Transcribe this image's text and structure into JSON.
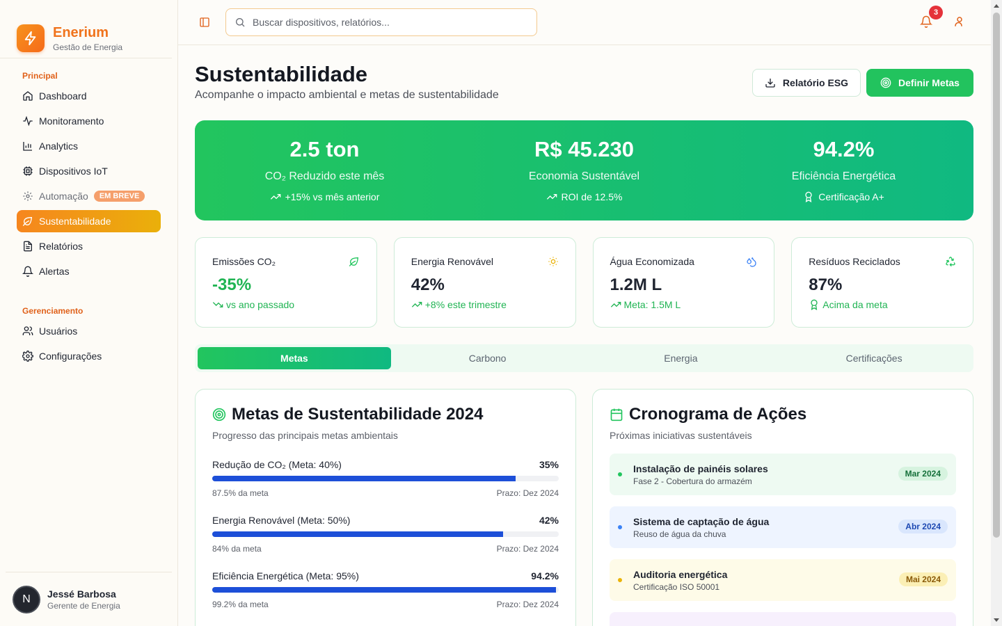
{
  "brand": {
    "name": "Enerium",
    "subtitle": "Gestão de Energia"
  },
  "sidebar": {
    "section_main": "Principal",
    "main_items": [
      {
        "label": "Dashboard",
        "icon": "home-icon"
      },
      {
        "label": "Monitoramento",
        "icon": "activity-icon"
      },
      {
        "label": "Analytics",
        "icon": "bar-chart-icon"
      },
      {
        "label": "Dispositivos IoT",
        "icon": "cpu-icon"
      },
      {
        "label": "Automação",
        "icon": "gear-icon",
        "badge": "EM BREVE"
      },
      {
        "label": "Sustentabilidade",
        "icon": "leaf-icon",
        "active": true
      },
      {
        "label": "Relatórios",
        "icon": "file-text-icon"
      },
      {
        "label": "Alertas",
        "icon": "bell-icon"
      }
    ],
    "section_manage": "Gerenciamento",
    "manage_items": [
      {
        "label": "Usuários",
        "icon": "users-icon"
      },
      {
        "label": "Configurações",
        "icon": "settings-icon"
      }
    ],
    "user": {
      "initial": "N",
      "name": "Jessé Barbosa",
      "role": "Gerente de Energia"
    }
  },
  "header": {
    "search_placeholder": "Buscar dispositivos, relatórios...",
    "notification_count": "3"
  },
  "page": {
    "title": "Sustentabilidade",
    "subtitle": "Acompanhe o impacto ambiental e metas de sustentabilidade",
    "btn_report": "Relatório ESG",
    "btn_goals": "Definir Metas"
  },
  "hero": [
    {
      "value": "2.5 ton",
      "label": "CO₂ Reduzido este mês",
      "note": "+15% vs mês anterior",
      "icon": "trending-up-icon"
    },
    {
      "value": "R$ 45.230",
      "label": "Economia Sustentável",
      "note": "ROI de 12.5%",
      "icon": "trending-up-icon"
    },
    {
      "value": "94.2%",
      "label": "Eficiência Energética",
      "note": "Certificação A+",
      "icon": "award-icon"
    }
  ],
  "cards": [
    {
      "title": "Emissões CO₂",
      "value": "-35%",
      "note": "vs ano passado",
      "icon": "leaf-icon"
    },
    {
      "title": "Energia Renovável",
      "value": "42%",
      "note": "+8% este trimestre",
      "icon": "sun-icon"
    },
    {
      "title": "Água Economizada",
      "value": "1.2M L",
      "note": "Meta: 1.5M L",
      "icon": "droplets-icon"
    },
    {
      "title": "Resíduos Reciclados",
      "value": "87%",
      "note": "Acima da meta",
      "icon": "recycle-icon"
    }
  ],
  "tabs": [
    "Metas",
    "Carbono",
    "Energia",
    "Certificações"
  ],
  "goals_panel": {
    "title": "Metas de Sustentabilidade 2024",
    "subtitle": "Progresso das principais metas ambientais",
    "goals": [
      {
        "label": "Redução de CO₂ (Meta: 40%)",
        "value": "35%",
        "progress": 87.5,
        "meta": "87.5% da meta",
        "deadline": "Prazo: Dez 2024"
      },
      {
        "label": "Energia Renovável (Meta: 50%)",
        "value": "42%",
        "progress": 84,
        "meta": "84% da meta",
        "deadline": "Prazo: Dez 2024"
      },
      {
        "label": "Eficiência Energética (Meta: 95%)",
        "value": "94.2%",
        "progress": 99.2,
        "meta": "99.2% da meta",
        "deadline": "Prazo: Dez 2024"
      }
    ]
  },
  "actions_panel": {
    "title": "Cronograma de Ações",
    "subtitle": "Próximas iniciativas sustentáveis",
    "actions": [
      {
        "title": "Instalação de painéis solares",
        "sub": "Fase 2 - Cobertura do armazém",
        "date": "Mar 2024"
      },
      {
        "title": "Sistema de captação de água",
        "sub": "Reuso de água da chuva",
        "date": "Abr 2024"
      },
      {
        "title": "Auditoria energética",
        "sub": "Certificação ISO 50001",
        "date": "Mai 2024"
      }
    ]
  }
}
